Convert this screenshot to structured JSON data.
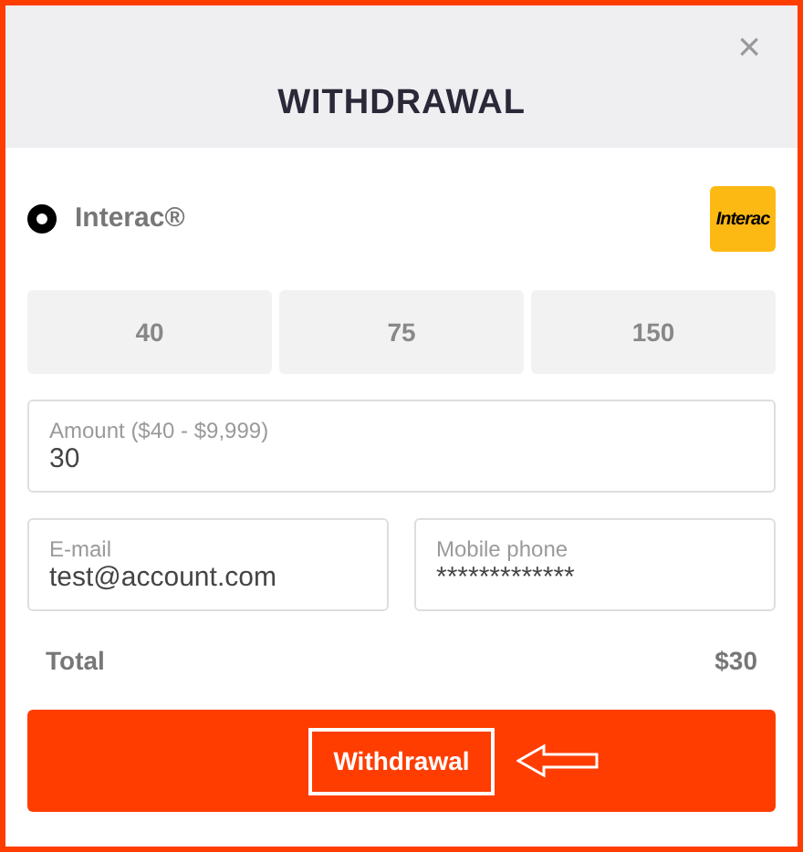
{
  "dialog": {
    "title": "WITHDRAWAL",
    "close": "×"
  },
  "payment_methods": [
    {
      "label": "Interac®",
      "selected": true,
      "logo_text": "Interac"
    }
  ],
  "presets": [
    {
      "label": "40",
      "selected": false
    },
    {
      "label": "75",
      "selected": false
    },
    {
      "label": "150",
      "selected": false
    }
  ],
  "amount": {
    "label": "Amount ($40 - $9,999)",
    "value": "30"
  },
  "email": {
    "label": "E-mail",
    "value": "test@account.com"
  },
  "phone": {
    "label": "Mobile phone",
    "value": "*************"
  },
  "total": {
    "label": "Total",
    "value": "$30"
  },
  "submit": {
    "label": "Withdrawal",
    "highlighted": true
  }
}
